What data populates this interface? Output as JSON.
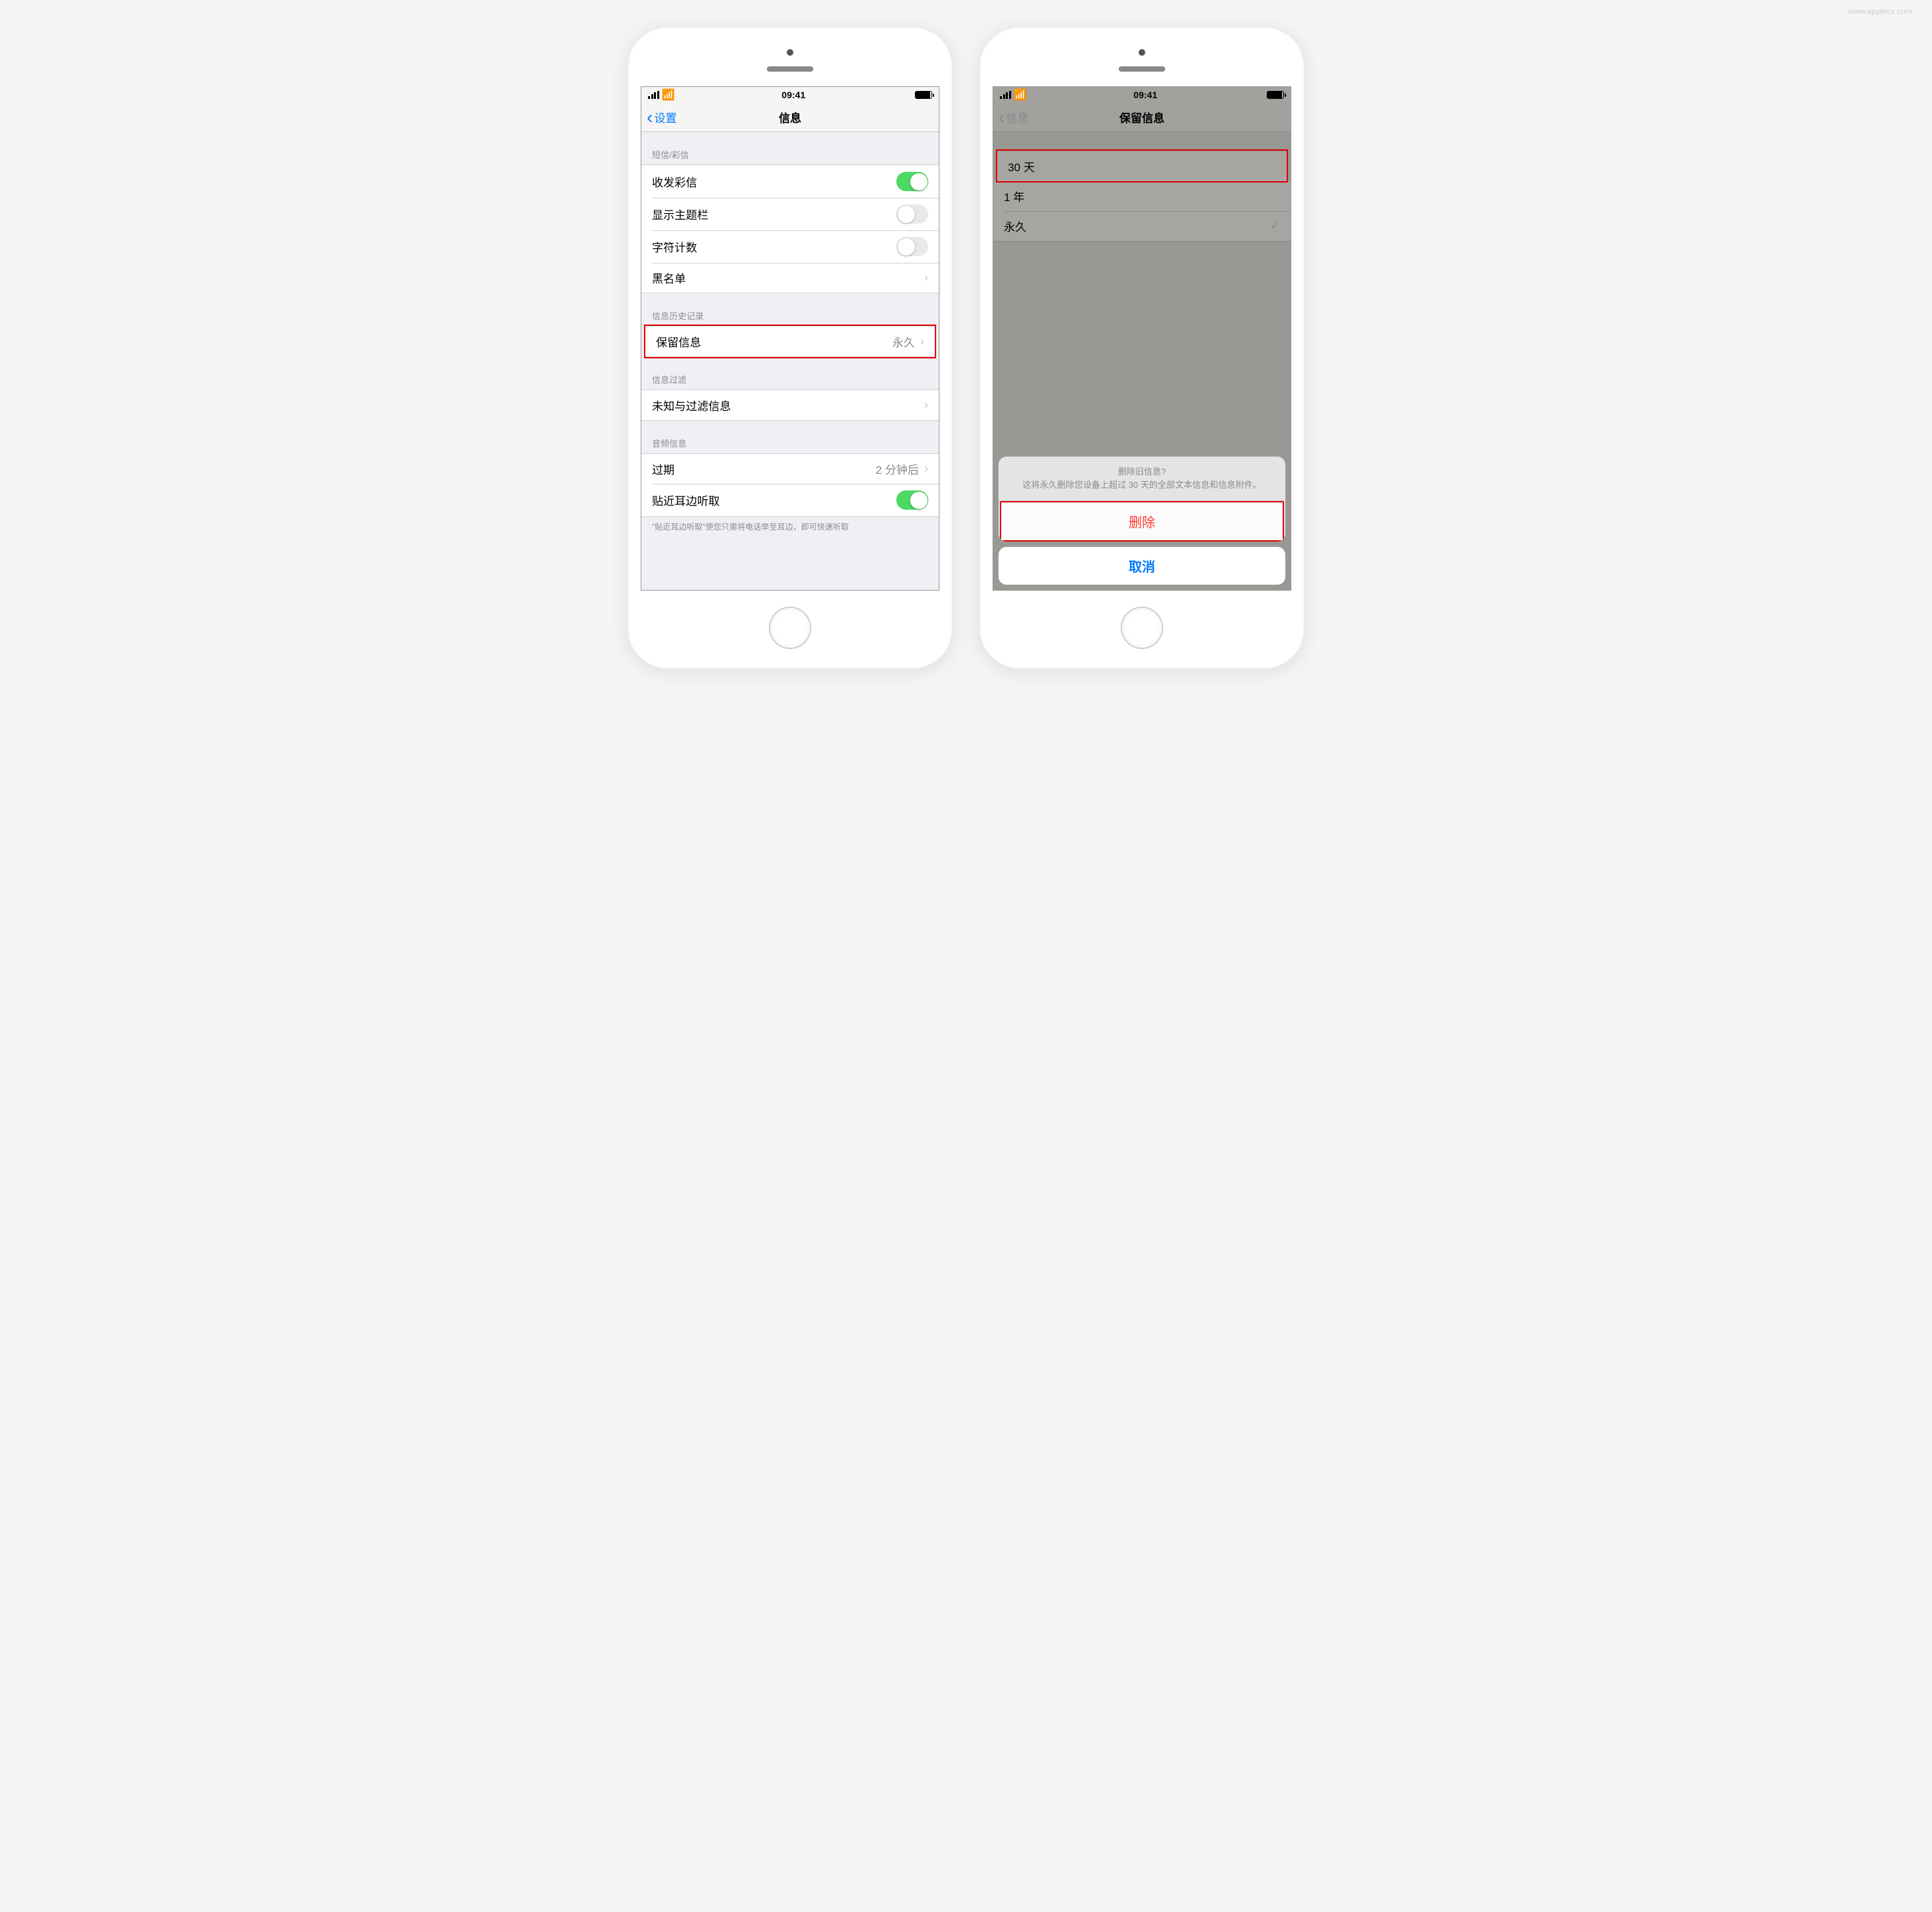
{
  "watermark": "www.applecx.com",
  "status_time": "09:41",
  "left": {
    "nav": {
      "back": "设置",
      "title": "信息"
    },
    "sections": {
      "sms": {
        "header": "短信/彩信",
        "mms": "收发彩信",
        "subject": "显示主题栏",
        "charcount": "字符计数",
        "blacklist": "黑名单"
      },
      "history": {
        "header": "信息历史记录",
        "keep": "保留信息",
        "keep_value": "永久"
      },
      "filter": {
        "header": "信息过滤",
        "unknown": "未知与过滤信息"
      },
      "audio": {
        "header": "音频信息",
        "expire": "过期",
        "expire_value": "2 分钟后",
        "raise": "贴近耳边听取"
      },
      "footnote": "\"贴近耳边听取\"使您只需将电话举至耳边，即可快速听取"
    }
  },
  "right": {
    "nav": {
      "back": "信息",
      "title": "保留信息"
    },
    "options": {
      "d30": "30 天",
      "y1": "1 年",
      "forever": "永久"
    },
    "sheet": {
      "title": "删除旧信息?",
      "body": "这将永久删除您设备上超过 30 天的全部文本信息和信息附件。",
      "delete": "删除",
      "cancel": "取消"
    }
  }
}
